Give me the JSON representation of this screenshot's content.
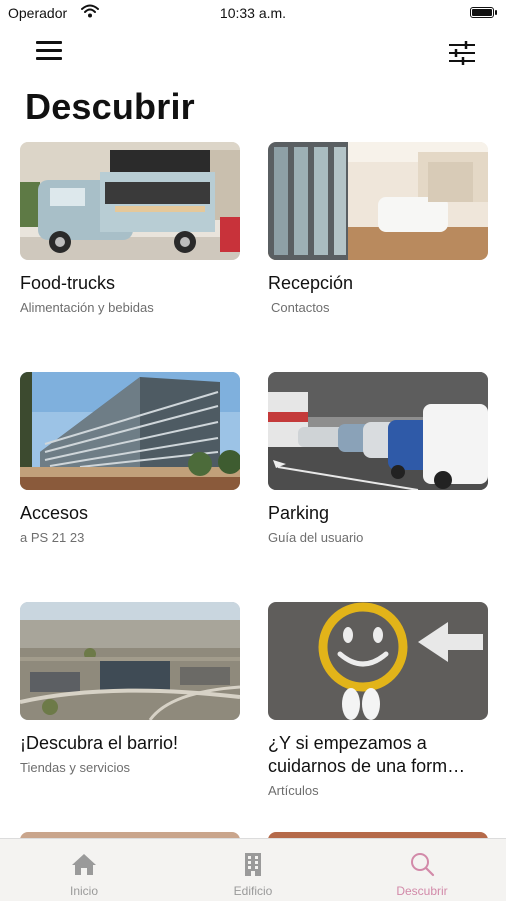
{
  "status_bar": {
    "carrier": "Operador",
    "time": "10:33 a.m."
  },
  "header": {
    "title": "Descubrir"
  },
  "cards": [
    {
      "title": "Food-trucks",
      "subtitle": "Alimentación y bebidas"
    },
    {
      "title": "Recepción",
      "subtitle": "Contactos"
    },
    {
      "title": "Accesos",
      "subtitle": "a PS 21 23"
    },
    {
      "title": "Parking",
      "subtitle": "Guía del usuario"
    },
    {
      "title": "¡Descubra el barrio!",
      "subtitle": "Tiendas y servicios"
    },
    {
      "title": "¿Y si empezamos a cuidarnos de una form…",
      "subtitle": "Artículos"
    }
  ],
  "tabs": [
    {
      "label": "Inicio",
      "icon": "home-icon"
    },
    {
      "label": "Edificio",
      "icon": "building-icon"
    },
    {
      "label": "Descubrir",
      "icon": "search-icon"
    }
  ],
  "colors": {
    "accent": "#d28aa9",
    "inactive": "#9a9a9a",
    "subtitle": "#6e6e6e"
  }
}
